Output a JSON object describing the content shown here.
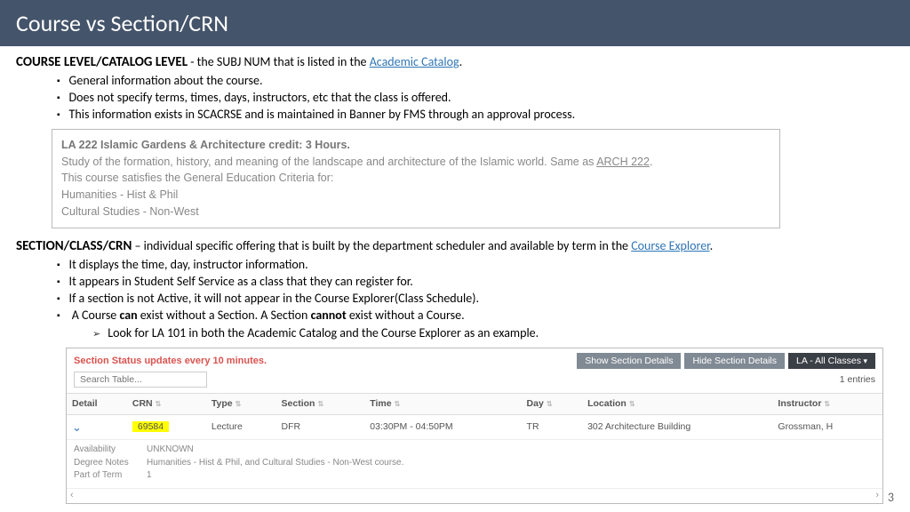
{
  "title": "Course vs Section/CRN",
  "page_number": "3",
  "course_level": {
    "heading_bold": "COURSE LEVEL/CATALOG LEVEL",
    "heading_rest": " - the SUBJ NUM that is listed in the ",
    "link_text": "Academic Catalog",
    "heading_tail": ".",
    "bullets": [
      "General information about the course.",
      "Does not specify terms, times, days, instructors, etc that the class is offered.",
      "This information exists in SCACRSE and is maintained in Banner by FMS through an approval process."
    ],
    "catalog_box": {
      "line1": "LA 222   Islamic Gardens & Architecture   credit: 3 Hours.",
      "desc_a": "Study of the formation, history, and meaning of the landscape and architecture of the Islamic world. Same as ",
      "desc_link": "ARCH 222",
      "desc_b": ".",
      "gened_intro": "This course satisfies the General Education Criteria for:",
      "gened1": "Humanities - Hist & Phil",
      "gened2": "Cultural Studies - Non-West"
    }
  },
  "section_level": {
    "heading_bold": "SECTION/CLASS/CRN",
    "heading_rest": " – individual specific offering that is built by the department scheduler and available by term in the ",
    "link_text": "Course Explorer",
    "heading_tail": ".",
    "bullets": [
      "It displays the time, day, instructor information.",
      "It appears in Student Self Service as a class that they can register for.",
      "If a section is not Active, it will not appear in the Course Explorer(Class Schedule)."
    ],
    "bullet4_a": "A Course ",
    "bullet4_b1": "can",
    "bullet4_c": " exist without a Section. A Section ",
    "bullet4_b2": "cannot",
    "bullet4_d": " exist without a Course.",
    "sub_bullet": "Look for LA 101 in both the Academic Catalog and the Course Explorer as an example."
  },
  "explorer": {
    "status_text": "Section Status updates every 10 minutes.",
    "btn_show": "Show Section Details",
    "btn_hide": "Hide Section Details",
    "btn_filter": "LA - All Classes",
    "search_placeholder": "Search Table...",
    "entries": "1 entries",
    "headers": {
      "detail": "Detail",
      "crn": "CRN",
      "type": "Type",
      "section": "Section",
      "time": "Time",
      "day": "Day",
      "location": "Location",
      "instructor": "Instructor"
    },
    "row": {
      "crn": "69584",
      "type": "Lecture",
      "section": "DFR",
      "time": "03:30PM - 04:50PM",
      "day": "TR",
      "location": "302 Architecture Building",
      "instructor": "Grossman, H"
    },
    "details": {
      "avail_label": "Availability",
      "avail_val": "UNKNOWN",
      "degree_label": "Degree Notes",
      "degree_val": "Humanities - Hist & Phil, and Cultural Studies - Non-West course.",
      "pot_label": "Part of Term",
      "pot_val": "1"
    }
  }
}
